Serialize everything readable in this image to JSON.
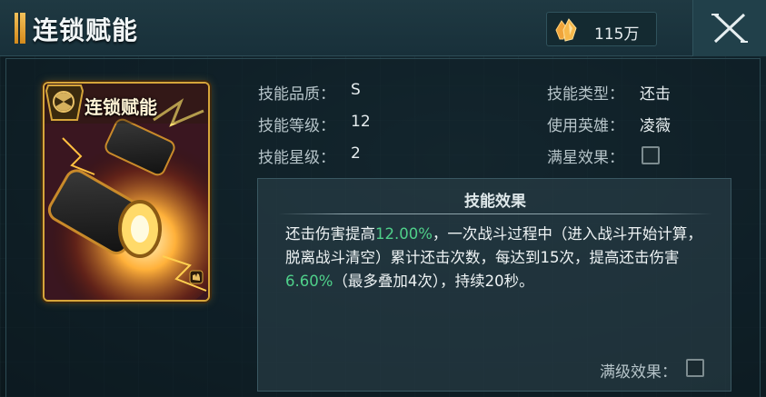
{
  "header": {
    "title": "连锁赋能",
    "currency_value": "115万",
    "currency_icon": "gold-crystal-icon",
    "close_icon": "close-icon"
  },
  "card": {
    "title": "连锁赋能",
    "emblem_icon": "radiation-emblem-icon",
    "corner_icon": "fist-icon"
  },
  "info": {
    "quality_label": "技能品质：",
    "quality_value": "S",
    "level_label": "技能等级：",
    "level_value": "12",
    "star_label": "技能星级：",
    "star_value": "2",
    "type_label": "技能类型：",
    "type_value": "还击",
    "hero_label": "使用英雄：",
    "hero_value": "凌薇",
    "fullstar_label": "满星效果："
  },
  "effect": {
    "title": "技能效果",
    "part1": "还击伤害提高",
    "value1": "12.00%",
    "part2": "，一次战斗过程中（进入战斗开始计算，脱离战斗清空）累计还击次数，每达到15次，提高还击伤害",
    "value2": "6.60%",
    "part3": "（最多叠加4次），持续20秒。",
    "maxlevel_label": "满级效果：",
    "highlight_color": "#4fd08a"
  },
  "colors": {
    "accent_gold": "#d6a53a",
    "panel_bg": "#0e1c22"
  }
}
